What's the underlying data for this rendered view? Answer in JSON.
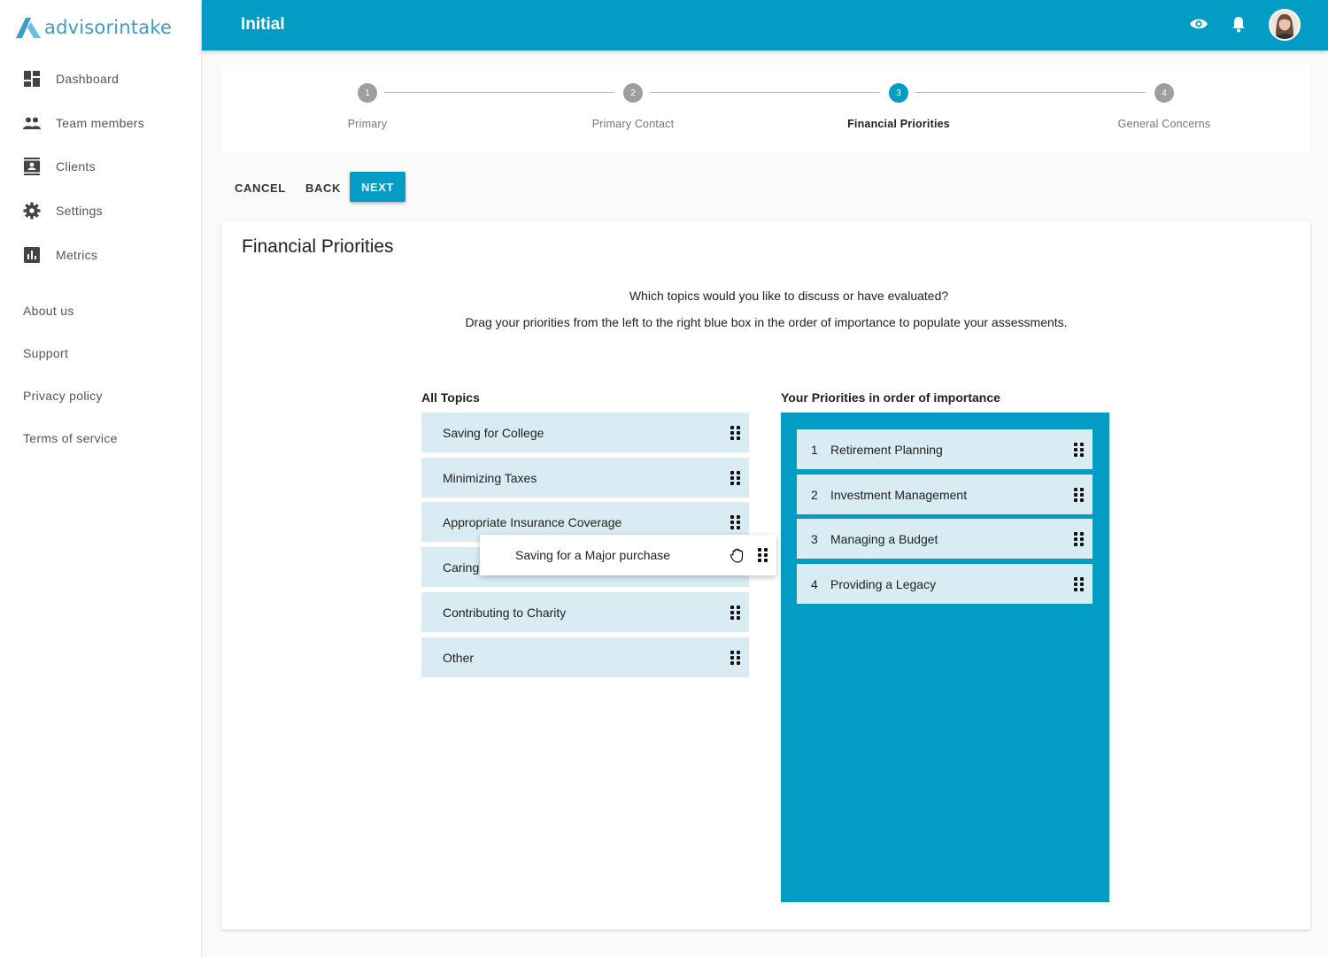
{
  "app": {
    "logo_text": "advisorintake",
    "brand_color": "#029cc4",
    "logo_color": "#3a9cc7"
  },
  "sidebar": {
    "items": [
      {
        "label": "Dashboard",
        "icon": "dashboard-icon"
      },
      {
        "label": "Team members",
        "icon": "people-icon"
      },
      {
        "label": "Clients",
        "icon": "contact-card-icon"
      },
      {
        "label": "Settings",
        "icon": "gear-icon"
      },
      {
        "label": "Metrics",
        "icon": "bar-chart-icon"
      }
    ],
    "links": [
      "About us",
      "Support",
      "Privacy policy",
      "Terms of service"
    ]
  },
  "header": {
    "title": "Initial",
    "icons": [
      "eye-icon",
      "bell-icon",
      "user-avatar"
    ]
  },
  "stepper": {
    "steps": [
      {
        "number": "1",
        "label": "Primary",
        "active": false
      },
      {
        "number": "2",
        "label": "Primary Contact",
        "active": false
      },
      {
        "number": "3",
        "label": "Financial Priorities",
        "active": true
      },
      {
        "number": "4",
        "label": "General Concerns",
        "active": false
      }
    ]
  },
  "actions": {
    "cancel": "CANCEL",
    "back": "BACK",
    "next": "NEXT"
  },
  "card": {
    "title": "Financial Priorities",
    "question": "Which topics would you like to discuss or have evaluated?",
    "instructions": "Drag your priorities from the left to the right blue box in the order of importance to populate your assessments.",
    "all_topics_heading": "All Topics",
    "priorities_heading": "Your Priorities in order of importance",
    "all_topics": [
      "Saving for College",
      "Minimizing Taxes",
      "Appropriate Insurance Coverage",
      "Caring",
      "Contributing to Charity",
      "Other"
    ],
    "priorities": [
      {
        "rank": "1",
        "label": "Retirement Planning"
      },
      {
        "rank": "2",
        "label": "Investment Management"
      },
      {
        "rank": "3",
        "label": "Managing a Budget"
      },
      {
        "rank": "4",
        "label": "Providing a Legacy"
      }
    ],
    "dragging_item": "Saving for a Major purchase"
  }
}
